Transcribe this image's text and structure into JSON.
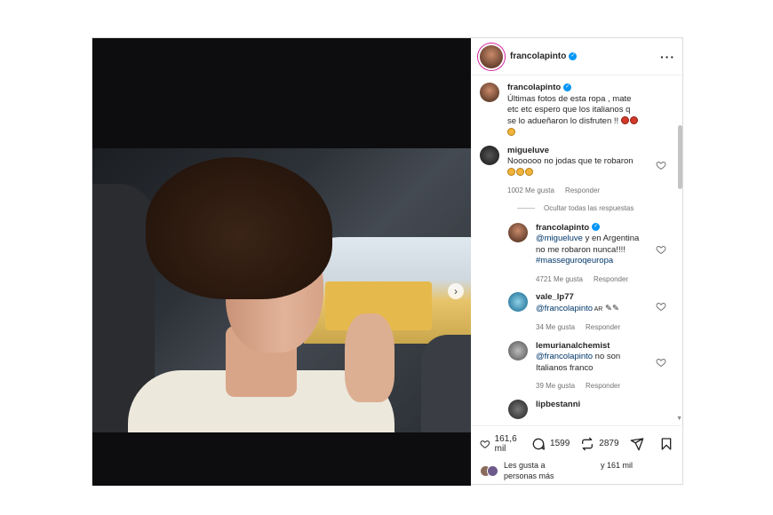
{
  "header": {
    "username": "francolapinto",
    "more": "···"
  },
  "caption": {
    "username": "francolapinto",
    "text": "Últimas fotos de esta ropa , mate etc etc espero que los italianos q se lo adueñaron lo disfruten !!"
  },
  "comments": [
    {
      "username": "migueluve",
      "text": "Noooooo no jodas que te robaron",
      "likes": "1002 Me gusta",
      "reply": "Responder"
    },
    {
      "username": "francolapinto",
      "mention": "@migueluve",
      "text": " y en Argentina no me robaron nunca!!!! ",
      "tag": "#masseguroqeuropa",
      "likes": "4721 Me gusta",
      "reply": "Responder"
    },
    {
      "username": "vale_lp77",
      "mention": "@francolapinto",
      "text": " AR",
      "likes": "34 Me gusta",
      "reply": "Responder"
    },
    {
      "username": "lemurianalchemist",
      "mention": "@francolapinto",
      "text": " no son Italianos franco",
      "likes": "39 Me gusta",
      "reply": "Responder"
    },
    {
      "username": "lipbestanni"
    }
  ],
  "hide_replies": "Ocultar todas las respuestas",
  "actions": {
    "likes": "161,6 mil",
    "comments": "1599",
    "reposts": "2879"
  },
  "liked_by": {
    "text": "Les gusta a personas más",
    "count": "y 161 mil"
  },
  "colors": {
    "verified": "#0095f6",
    "mention": "#00376b"
  }
}
